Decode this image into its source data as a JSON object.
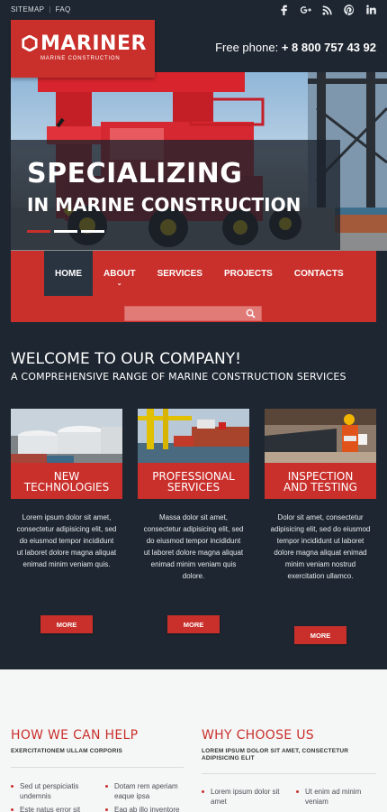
{
  "topbar": {
    "links": [
      "SITEMAP",
      "FAQ"
    ],
    "social": [
      "facebook-icon",
      "google-plus-icon",
      "rss-icon",
      "pinterest-icon",
      "linkedin-icon"
    ]
  },
  "header": {
    "logo_name": "MARINER",
    "logo_tag": "MARINE CONSTRUCTION",
    "phone_label": "Free phone:",
    "phone_number": "+ 8 800 757 43 92"
  },
  "hero": {
    "line1": "SPECIALIZING",
    "line2": "IN MARINE CONSTRUCTION",
    "slides": 3,
    "active_slide": 1
  },
  "nav": {
    "items": [
      {
        "label": "HOME",
        "active": true
      },
      {
        "label": "ABOUT",
        "has_submenu": true
      },
      {
        "label": "SERVICES"
      },
      {
        "label": "PROJECTS"
      },
      {
        "label": "CONTACTS"
      }
    ],
    "search_placeholder": ""
  },
  "intro": {
    "title": "WELCOME TO OUR COMPANY!",
    "subtitle": "A COMPREHENSIVE RANGE OF MARINE CONSTRUCTION SERVICES"
  },
  "cards": [
    {
      "title1": "NEW",
      "title2": "TECHNOLOGIES",
      "text": "Lorem ipsum dolor sit amet, consectetur adipisicing elit, sed do eiusmod tempor incididunt ut laboret dolore magna aliquat enimad minim veniam quis.",
      "button": "MORE"
    },
    {
      "title1": "PROFESSIONAL",
      "title2": "SERVICES",
      "text": "Massa dolor sit amet, consectetur adipisicing elit, sed do eiusmod tempor incididunt ut laboret dolore magna aliquat enimad minim veniam quis dolore.",
      "button": "MORE"
    },
    {
      "title1": "INSPECTION",
      "title2": "AND TESTING",
      "text": "Dolor sit amet, consectetur adipisicing elit, sed do eiusmod tempor incididunt ut laboret dolore magna aliquat enimad minim veniam nostrud exercitation ullamco.",
      "button": "MORE"
    }
  ],
  "help": {
    "title": "HOW WE CAN HELP",
    "subtitle": "EXERCITATIONEM ULLAM CORPORIS",
    "left_items": [
      "Sed ut perspiciatis undemnis",
      "Este natus error sit"
    ],
    "right_items": [
      "Dotam rem aperiam eaque ipsa",
      "Eaq ab illo inventore"
    ]
  },
  "why": {
    "title": "WHY CHOOSE US",
    "subtitle": "LOREM IPSUM DOLOR SIT AMET, CONSECTETUR ADIPISICING ELIT",
    "left_items": [
      "Lorem ipsum dolor sit amet"
    ],
    "right_items": [
      "Ut enim ad minim veniam"
    ]
  },
  "colors": {
    "accent": "#c9302c",
    "dark": "#1e2731",
    "light": "#f5f6f6"
  }
}
